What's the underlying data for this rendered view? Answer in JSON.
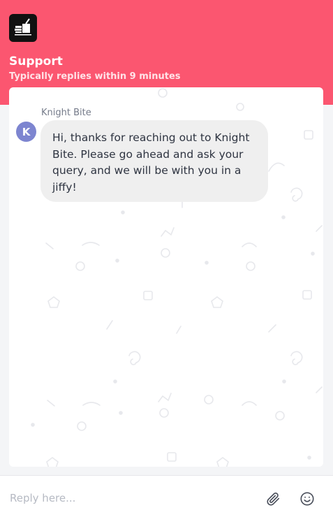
{
  "header": {
    "title": "Support",
    "subtitle": "Typically replies within 9 minutes",
    "background_color": "#fb5670",
    "logo_icon": "food-delivery-icon"
  },
  "conversation": {
    "sender_name": "Knight Bite",
    "avatar_initial": "K",
    "avatar_color": "#7d85d0",
    "message": "Hi, thanks for reaching out to Knight Bite. Please go ahead and ask your query, and we will be with you in a jiffy!"
  },
  "composer": {
    "placeholder": "Reply here...",
    "attach_icon": "paperclip-icon",
    "emoji_icon": "smiley-icon"
  }
}
